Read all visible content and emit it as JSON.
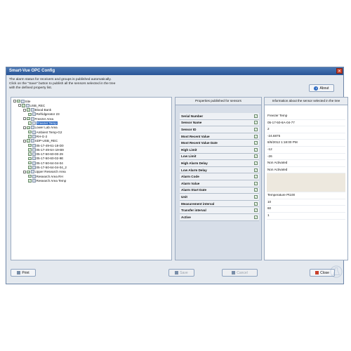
{
  "window": {
    "title": "Smart-Vue OPC Config",
    "close_glyph": "✕",
    "instruction_lines": [
      "The alarm status for receivers and groups is published automatically.",
      "Click on the \"Save\" button to publish all the sensors selected in the tree",
      "with the defined property list."
    ]
  },
  "about_button": {
    "label": "About",
    "icon": "info-icon"
  },
  "tree": {
    "nodes": [
      {
        "label": "Site",
        "depth": 0,
        "expander": "-",
        "checked": true,
        "icon": "site-icon"
      },
      {
        "label": "USB_REC",
        "depth": 1,
        "expander": "-",
        "checked": true,
        "icon": "receiver-icon"
      },
      {
        "label": "Blood Bank",
        "depth": 2,
        "expander": "-",
        "checked": true,
        "icon": "group-icon"
      },
      {
        "label": "Refridgerator 23",
        "depth": 3,
        "expander": "",
        "checked": true,
        "icon": "sensor-icon"
      },
      {
        "label": "Freezer Area",
        "depth": 2,
        "expander": "-",
        "checked": true,
        "icon": "group-icon"
      },
      {
        "label": "Freezer Temp",
        "depth": 3,
        "expander": "",
        "checked": true,
        "icon": "sensor-icon",
        "selected": true
      },
      {
        "label": "Lower Lab Area",
        "depth": 2,
        "expander": "-",
        "checked": true,
        "icon": "group-icon"
      },
      {
        "label": "Ambient Temp-G2",
        "depth": 3,
        "expander": "",
        "checked": true,
        "icon": "sensor-icon"
      },
      {
        "label": "RH-G-2",
        "depth": 3,
        "expander": "",
        "checked": true,
        "icon": "sensor-icon"
      },
      {
        "label": "SDP-USB_REC",
        "depth": 2,
        "expander": "-",
        "checked": true,
        "icon": "group-icon"
      },
      {
        "label": "05-17-49-61-18-D0",
        "depth": 3,
        "expander": "",
        "checked": true,
        "icon": "sensor-icon"
      },
      {
        "label": "05-17-49-6A-19-B9",
        "depth": 3,
        "expander": "",
        "checked": true,
        "icon": "sensor-icon"
      },
      {
        "label": "05-17-50-60-00-29",
        "depth": 3,
        "expander": "",
        "checked": true,
        "icon": "sensor-icon"
      },
      {
        "label": "05-17-50-60-02-9E",
        "depth": 3,
        "expander": "",
        "checked": true,
        "icon": "sensor-icon"
      },
      {
        "label": "05-17-50-64-04-04",
        "depth": 3,
        "expander": "",
        "checked": true,
        "icon": "sensor-icon"
      },
      {
        "label": "05-17-50-64-04-04_2",
        "depth": 3,
        "expander": "",
        "checked": true,
        "icon": "sensor-icon"
      },
      {
        "label": "Upper Research Area",
        "depth": 2,
        "expander": "-",
        "checked": true,
        "icon": "group-icon"
      },
      {
        "label": "Research Area RH",
        "depth": 3,
        "expander": "",
        "checked": true,
        "icon": "sensor-icon"
      },
      {
        "label": "Research Area Temp",
        "depth": 3,
        "expander": "",
        "checked": true,
        "icon": "sensor-icon"
      }
    ]
  },
  "properties_panel": {
    "header": "Properties published for sensors",
    "rows": [
      {
        "label": "Serial Number",
        "checked": true
      },
      {
        "label": "Sensor Name",
        "checked": true
      },
      {
        "label": "Sensor ID",
        "checked": true
      },
      {
        "label": "Most Recent Value",
        "checked": true
      },
      {
        "label": "Most Recent Value Date",
        "checked": true
      },
      {
        "label": "High Limit",
        "checked": true
      },
      {
        "label": "Low Limit",
        "checked": true
      },
      {
        "label": "High Alarm Delay",
        "checked": true
      },
      {
        "label": "Low Alarm Delay",
        "checked": true
      },
      {
        "label": "Alarm Code",
        "checked": true
      },
      {
        "label": "Alarm Value",
        "checked": true
      },
      {
        "label": "Alarm Start Date",
        "checked": true
      },
      {
        "label": "Unit",
        "checked": true
      },
      {
        "label": "Measurement interval",
        "checked": true
      },
      {
        "label": "Transfer interval",
        "checked": true
      },
      {
        "label": "Active",
        "checked": true
      }
    ]
  },
  "info_panel": {
    "header": "Information about the sensor selected in the tree",
    "values": [
      "Freezer Temp",
      "05-17-50-6A-04-77",
      "2",
      "-24.6875",
      "8/6/2012 1:18:00 PM",
      "-12",
      "-26",
      "Non Activated",
      "Non Activated",
      "",
      "Temperature Pt100",
      "10",
      "60",
      "1"
    ]
  },
  "buttons": {
    "print": "Print",
    "save": "Save",
    "cancel": "Cancel",
    "close": "Close"
  },
  "check_glyph": "✓"
}
